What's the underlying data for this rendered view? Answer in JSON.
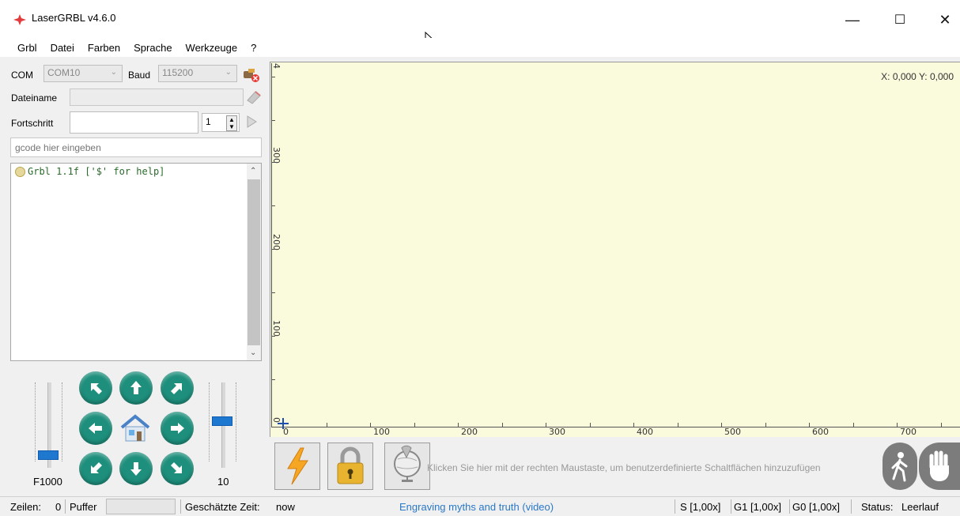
{
  "window": {
    "title": "LaserGRBL v4.6.0",
    "minimize": "—",
    "maximize": "☐",
    "close": "✕"
  },
  "menu": {
    "items": [
      "Grbl",
      "Datei",
      "Farben",
      "Sprache",
      "Werkzeuge",
      "?"
    ]
  },
  "connection": {
    "com_label": "COM",
    "com_value": "COM10",
    "baud_label": "Baud",
    "baud_value": "115200"
  },
  "file": {
    "filename_label": "Dateiname",
    "filename_value": "",
    "progress_label": "Fortschritt",
    "progress_value": "",
    "repeat_value": "1"
  },
  "gcode": {
    "placeholder": "gcode hier eingeben"
  },
  "console": {
    "lines": [
      "Grbl 1.1f ['$' for help]"
    ]
  },
  "jog": {
    "speed_label": "F1000",
    "step_label": "10",
    "speed_fraction": 0.1,
    "step_fraction": 0.55
  },
  "canvas": {
    "coords": "X: 0,000 Y: 0,000",
    "y_ticks": [
      "0",
      "100",
      "200",
      "300",
      "4"
    ],
    "x_ticks": [
      "0",
      "100",
      "200",
      "300",
      "400",
      "500",
      "600",
      "700"
    ],
    "background": "#fafadc"
  },
  "buttons": {
    "hint": "Klicken Sie hier mit der rechten Maustaste, um benutzerdefinierte Schaltflächen hinzuzufügen"
  },
  "status": {
    "lines_label": "Zeilen:",
    "lines_value": "0",
    "buffer_label": "Puffer",
    "time_label": "Geschätzte Zeit:",
    "time_value": "now",
    "link": "Engraving myths and truth (video)",
    "s_override": "S [1,00x]",
    "g1_override": "G1 [1,00x]",
    "g0_override": "G0 [1,00x]",
    "state_label": "Status:",
    "state_value": "Leerlauf"
  },
  "colors": {
    "jog_button": "#1e8f7c",
    "accent": "#1e78d0",
    "link": "#2a78c8"
  }
}
